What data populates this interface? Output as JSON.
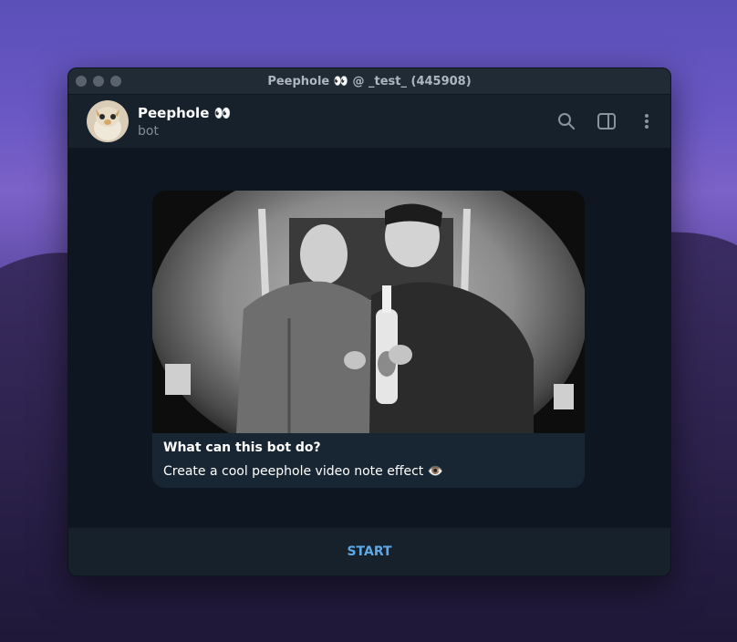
{
  "window": {
    "title": "Peephole 👀 @ _test_ (445908)"
  },
  "header": {
    "chat_name": "Peephole 👀",
    "chat_status": "bot",
    "icons": [
      "search-icon",
      "sidebar-toggle-icon",
      "more-vertical-icon"
    ]
  },
  "bot_info": {
    "heading": "What can this bot do?",
    "description": "Create a cool peephole video note effect 👁️"
  },
  "footer": {
    "start_label": "START"
  },
  "colors": {
    "window_bg": "#17212b",
    "chat_bg": "#0e1621",
    "card_bg": "#182533",
    "accent": "#5fa8e8"
  }
}
